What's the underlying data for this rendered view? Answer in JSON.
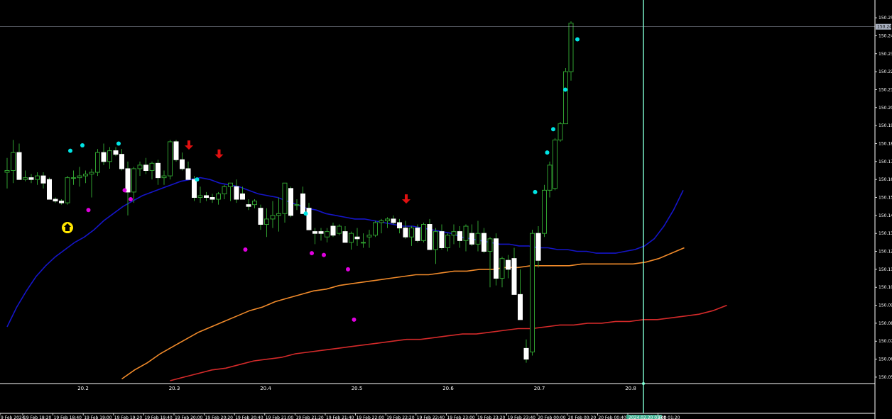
{
  "chart_data": {
    "type": "candlestick",
    "colors": {
      "background": "#000000",
      "axis": "#ffffff",
      "bull_fill": "#000000",
      "bull_outline": "#2f9e2f",
      "bear_fill": "#ffffff",
      "bear_outline": "#ffffff",
      "wick": "#2f9e2f",
      "ma_fast": "#1515c8",
      "ma_mid": "#f08a2a",
      "ma_slow": "#d42a2a",
      "cursor_line": "#7fffd4",
      "price_line": "#a8b0c0",
      "signal_up_arrow": "#ffe600",
      "signal_down_arrow": "#e01010",
      "dot_high": "#00e5e5",
      "dot_low": "#e000e0"
    },
    "price_ticks": [
      "150.250",
      "150.240",
      "150.230",
      "150.220",
      "150.210",
      "150.200",
      "150.190",
      "150.180",
      "150.170",
      "150.160",
      "150.150",
      "150.140",
      "150.130",
      "150.120",
      "150.110",
      "150.100",
      "150.090",
      "150.080",
      "150.070",
      "150.060",
      "150.050"
    ],
    "current_price": "150.245",
    "subwindow_ticks": [
      "20.2",
      "20.3",
      "20.4",
      "20.5",
      "20.6",
      "20.7",
      "20.8"
    ],
    "subwindow_range": [
      20.1,
      20.85
    ],
    "time_labels": [
      "9 Feb 2024",
      "19 Feb 18:20",
      "19 Feb 18:40",
      "19 Feb 19:00",
      "19 Feb 19:20",
      "19 Feb 19:40",
      "19 Feb 20:00",
      "19 Feb 20:20",
      "19 Feb 20:40",
      "19 Feb 21:00",
      "19 Feb 21:20",
      "19 Feb 21:40",
      "19 Feb 22:00",
      "19 Feb 22:20",
      "19 Feb 22:40",
      "19 Feb 23:00",
      "19 Feb 23:20",
      "19 Feb 23:40",
      "20 Feb 00:00",
      "20 Feb 00:20",
      "20 Feb 00:40",
      "2024.02.20 01:00",
      "Feb 01:20"
    ],
    "cursor_time_label": "2024.02.20 01:00",
    "cursor_bar_index": 87,
    "ylim": [
      150.048,
      150.252
    ],
    "candles_ohlc": [
      [
        150.164,
        150.172,
        150.155,
        150.165
      ],
      [
        150.165,
        150.182,
        150.158,
        150.175
      ],
      [
        150.175,
        150.18,
        150.16,
        150.16
      ],
      [
        150.16,
        150.165,
        150.159,
        150.161
      ],
      [
        150.161,
        150.163,
        150.158,
        150.16
      ],
      [
        150.16,
        150.164,
        150.157,
        150.162
      ],
      [
        150.162,
        150.164,
        150.155,
        150.158
      ],
      [
        150.16,
        150.161,
        150.149,
        150.149
      ],
      [
        150.149,
        150.15,
        150.147,
        150.148
      ],
      [
        150.148,
        150.149,
        150.146,
        150.147
      ],
      [
        150.147,
        150.162,
        150.146,
        150.161
      ],
      [
        150.161,
        150.165,
        150.157,
        150.161
      ],
      [
        150.161,
        150.167,
        150.156,
        150.162
      ],
      [
        150.162,
        150.165,
        150.158,
        150.163
      ],
      [
        150.163,
        150.166,
        150.15,
        150.164
      ],
      [
        150.164,
        150.177,
        150.162,
        150.175
      ],
      [
        150.175,
        150.18,
        150.168,
        150.17
      ],
      [
        150.17,
        150.178,
        150.166,
        150.176
      ],
      [
        150.176,
        150.178,
        150.173,
        150.174
      ],
      [
        150.174,
        150.177,
        150.165,
        150.166
      ],
      [
        150.166,
        150.17,
        150.14,
        150.153
      ],
      [
        150.153,
        150.167,
        150.147,
        150.166
      ],
      [
        150.166,
        150.17,
        150.162,
        150.168
      ],
      [
        150.168,
        150.172,
        150.163,
        150.165
      ],
      [
        150.165,
        150.17,
        150.16,
        150.169
      ],
      [
        150.169,
        150.171,
        150.157,
        150.161
      ],
      [
        150.161,
        150.165,
        150.157,
        150.162
      ],
      [
        150.162,
        150.182,
        150.16,
        150.181
      ],
      [
        150.181,
        150.182,
        150.17,
        150.171
      ],
      [
        150.171,
        150.175,
        150.165,
        150.166
      ],
      [
        150.166,
        150.17,
        150.16,
        150.16
      ],
      [
        150.16,
        150.162,
        150.148,
        150.15
      ],
      [
        150.15,
        150.156,
        150.147,
        150.151
      ],
      [
        150.151,
        150.153,
        150.148,
        150.15
      ],
      [
        150.15,
        150.152,
        150.147,
        150.149
      ],
      [
        150.149,
        150.153,
        150.146,
        150.152
      ],
      [
        150.152,
        150.157,
        150.149,
        150.156
      ],
      [
        150.156,
        150.158,
        150.148,
        150.158
      ],
      [
        150.156,
        150.16,
        150.147,
        150.149
      ],
      [
        150.152,
        150.156,
        150.149,
        150.149
      ],
      [
        150.146,
        150.149,
        150.143,
        150.145
      ],
      [
        150.146,
        150.149,
        150.144,
        150.148
      ],
      [
        150.144,
        150.146,
        150.132,
        150.135
      ],
      [
        150.135,
        150.144,
        150.128,
        150.138
      ],
      [
        150.138,
        150.148,
        150.133,
        150.14
      ],
      [
        150.14,
        150.15,
        150.131,
        150.141
      ],
      [
        150.141,
        150.158,
        150.136,
        150.158
      ],
      [
        150.155,
        150.156,
        150.139,
        150.14
      ],
      [
        150.146,
        150.149,
        150.143,
        150.146
      ],
      [
        150.152,
        150.156,
        150.141,
        150.141
      ],
      [
        150.144,
        150.147,
        150.132,
        150.132
      ],
      [
        150.131,
        150.133,
        150.124,
        150.13
      ],
      [
        150.131,
        150.133,
        150.126,
        150.13
      ],
      [
        150.128,
        150.133,
        150.125,
        150.131
      ],
      [
        150.134,
        150.136,
        150.128,
        150.129
      ],
      [
        150.13,
        150.135,
        150.129,
        150.134
      ],
      [
        150.131,
        150.134,
        150.125,
        150.125
      ],
      [
        150.125,
        150.131,
        150.121,
        150.13
      ],
      [
        150.128,
        150.133,
        150.123,
        150.127
      ],
      [
        150.125,
        150.13,
        150.122,
        150.125
      ],
      [
        150.128,
        150.132,
        150.122,
        150.129
      ],
      [
        150.129,
        150.137,
        150.128,
        150.136
      ],
      [
        150.136,
        150.138,
        150.13,
        150.137
      ],
      [
        150.137,
        150.139,
        150.133,
        150.138
      ],
      [
        150.138,
        150.14,
        150.135,
        150.136
      ],
      [
        150.136,
        150.138,
        150.13,
        150.133
      ],
      [
        150.133,
        150.137,
        150.127,
        150.128
      ],
      [
        150.128,
        150.134,
        150.123,
        150.133
      ],
      [
        150.133,
        150.135,
        150.125,
        150.126
      ],
      [
        150.126,
        150.136,
        150.125,
        150.135
      ],
      [
        150.135,
        150.138,
        150.121,
        150.121
      ],
      [
        150.121,
        150.133,
        150.113,
        150.131
      ],
      [
        150.131,
        150.135,
        150.121,
        150.122
      ],
      [
        150.122,
        150.13,
        150.12,
        150.129
      ],
      [
        150.129,
        150.135,
        150.124,
        150.131
      ],
      [
        150.131,
        150.134,
        150.122,
        150.126
      ],
      [
        150.126,
        150.135,
        150.12,
        150.134
      ],
      [
        150.13,
        150.135,
        150.123,
        150.124
      ],
      [
        150.124,
        150.137,
        150.12,
        150.13
      ],
      [
        150.13,
        150.133,
        150.119,
        150.12
      ],
      [
        150.12,
        150.128,
        150.1,
        150.127
      ],
      [
        150.127,
        150.13,
        150.101,
        150.105
      ],
      [
        150.105,
        150.117,
        150.1,
        150.116
      ],
      [
        150.115,
        150.118,
        150.105,
        150.11
      ],
      [
        150.116,
        150.122,
        150.096,
        150.096
      ],
      [
        150.096,
        150.11,
        150.084,
        150.082
      ],
      [
        150.066,
        150.071,
        150.058,
        150.06
      ],
      [
        150.064,
        150.132,
        150.062,
        150.13
      ],
      [
        150.13,
        150.134,
        150.111,
        150.115
      ]
    ],
    "ma_fast": [
      150.078,
      150.089,
      150.098,
      150.106,
      150.112,
      150.117,
      150.121,
      150.125,
      150.128,
      150.132,
      150.137,
      150.141,
      150.145,
      150.148,
      150.151,
      150.153,
      150.155,
      150.157,
      150.159,
      150.16,
      150.161,
      150.16,
      150.158,
      150.157,
      150.156,
      150.154,
      150.152,
      150.151,
      150.15,
      150.148,
      150.146,
      150.144,
      150.143,
      150.141,
      150.14,
      150.139,
      150.138,
      150.138,
      150.137,
      150.136,
      150.135,
      150.134,
      150.134,
      150.133,
      150.132,
      150.131,
      150.13,
      150.128,
      150.127,
      150.126,
      150.125,
      150.124,
      150.124,
      150.123,
      150.123,
      150.122,
      150.122,
      150.121,
      150.121,
      150.12,
      150.12,
      150.119,
      150.119,
      150.119,
      150.12,
      150.121,
      150.123,
      150.127,
      150.134,
      150.143,
      150.154
    ],
    "ma_mid": [
      150.049,
      150.054,
      150.058,
      150.063,
      150.067,
      150.071,
      150.075,
      150.078,
      150.081,
      150.084,
      150.087,
      150.089,
      150.092,
      150.094,
      150.096,
      150.098,
      150.099,
      150.101,
      150.102,
      150.103,
      150.104,
      150.105,
      150.106,
      150.107,
      150.107,
      150.108,
      150.109,
      150.109,
      150.11,
      150.11,
      150.111,
      150.111,
      150.112,
      150.112,
      150.112,
      150.112,
      150.113,
      150.113,
      150.113,
      150.113,
      150.113,
      150.114,
      150.116,
      150.119,
      150.122
    ],
    "ma_slow": [
      150.048,
      150.05,
      150.052,
      150.054,
      150.055,
      150.057,
      150.059,
      150.06,
      150.061,
      150.063,
      150.064,
      150.065,
      150.066,
      150.067,
      150.068,
      150.069,
      150.07,
      150.071,
      150.071,
      150.072,
      150.073,
      150.074,
      150.074,
      150.075,
      150.076,
      150.077,
      150.077,
      150.078,
      150.079,
      150.079,
      150.08,
      150.08,
      150.081,
      150.081,
      150.082,
      150.082,
      150.083,
      150.084,
      150.085,
      150.087,
      150.09
    ],
    "rally_candles": [
      [
        150.13,
        150.157,
        150.128,
        150.154
      ],
      [
        150.154,
        150.17,
        150.15,
        150.168
      ],
      [
        150.155,
        150.183,
        150.154,
        150.182
      ],
      [
        150.182,
        150.192,
        150.181,
        150.191
      ],
      [
        150.191,
        150.222,
        150.191,
        150.22
      ],
      [
        150.22,
        150.248,
        150.215,
        150.247
      ]
    ],
    "signal_up_arrows": [
      {
        "bar": 6,
        "price": 150.149
      }
    ],
    "signal_down_arrows": [
      {
        "bar": 20,
        "price": 150.177
      },
      {
        "bar": 25,
        "price": 150.172
      },
      {
        "bar": 56,
        "price": 150.147
      }
    ],
    "dots_high": [
      {
        "bar": 10,
        "price": 150.176
      },
      {
        "bar": 12,
        "price": 150.179
      },
      {
        "bar": 18,
        "price": 150.18
      },
      {
        "bar": 31,
        "price": 150.16
      },
      {
        "bar": 49,
        "price": 150.141
      },
      {
        "bar": 87,
        "price": 150.153
      },
      {
        "bar": 89,
        "price": 150.175
      },
      {
        "bar": 90,
        "price": 150.188
      },
      {
        "bar": 92,
        "price": 150.21
      },
      {
        "bar": 94,
        "price": 150.238
      }
    ],
    "dots_low": [
      {
        "bar": 13,
        "price": 150.143
      },
      {
        "bar": 19,
        "price": 150.154
      },
      {
        "bar": 20,
        "price": 150.149
      },
      {
        "bar": 39,
        "price": 150.121
      },
      {
        "bar": 50,
        "price": 150.119
      },
      {
        "bar": 52,
        "price": 150.118
      },
      {
        "bar": 56,
        "price": 150.11
      },
      {
        "bar": 57,
        "price": 150.082
      }
    ]
  }
}
